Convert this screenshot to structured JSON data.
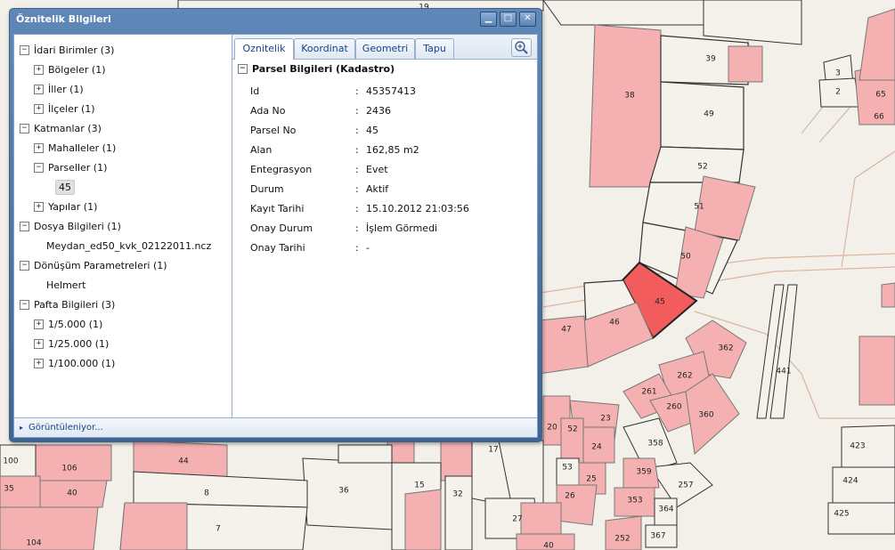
{
  "window": {
    "title": "Öznitelik Bilgileri",
    "buttons": {
      "minimize": "▁",
      "maximize": "□",
      "close": "✕"
    },
    "status_text": "Görüntüleniyor..."
  },
  "tree": [
    {
      "label": "İdari Birimler (3)",
      "expander": "−",
      "level": 0
    },
    {
      "label": "Bölgeler (1)",
      "expander": "+",
      "level": 1
    },
    {
      "label": "İller (1)",
      "expander": "+",
      "level": 1
    },
    {
      "label": "İlçeler (1)",
      "expander": "+",
      "level": 1
    },
    {
      "label": "Katmanlar (3)",
      "expander": "−",
      "level": 0
    },
    {
      "label": "Mahalleler (1)",
      "expander": "+",
      "level": 1
    },
    {
      "label": "Parseller (1)",
      "expander": "−",
      "level": 1
    },
    {
      "label": "45",
      "expander": "",
      "level": 2,
      "selected": true
    },
    {
      "label": "Yapılar (1)",
      "expander": "+",
      "level": 1
    },
    {
      "label": "Dosya Bilgileri (1)",
      "expander": "−",
      "level": 0
    },
    {
      "label": "Meydan_ed50_kvk_02122011.ncz",
      "expander": "",
      "level": 1
    },
    {
      "label": "Dönüşüm Parametreleri (1)",
      "expander": "−",
      "level": 0
    },
    {
      "label": "Helmert",
      "expander": "",
      "level": 1
    },
    {
      "label": "Pafta Bilgileri (3)",
      "expander": "−",
      "level": 0
    },
    {
      "label": "1/5.000 (1)",
      "expander": "+",
      "level": 1
    },
    {
      "label": "1/25.000 (1)",
      "expander": "+",
      "level": 1
    },
    {
      "label": "1/100.000 (1)",
      "expander": "+",
      "level": 1
    }
  ],
  "tabs": [
    {
      "label": "Oznitelik",
      "active": true
    },
    {
      "label": "Koordinat",
      "active": false
    },
    {
      "label": "Geometri",
      "active": false
    },
    {
      "label": "Tapu",
      "active": false
    }
  ],
  "section_title": "Parsel Bilgileri (Kadastro)",
  "section_expander": "−",
  "attributes": [
    {
      "key": "Id",
      "sep": ":",
      "value": "45357413"
    },
    {
      "key": "Ada No",
      "sep": ":",
      "value": "2436"
    },
    {
      "key": "Parsel No",
      "sep": ":",
      "value": "45"
    },
    {
      "key": "Alan",
      "sep": ":",
      "value": "162,85 m2"
    },
    {
      "key": "Entegrasyon",
      "sep": ":",
      "value": "Evet"
    },
    {
      "key": "Durum",
      "sep": ":",
      "value": "Aktif"
    },
    {
      "key": "Kayıt Tarihi",
      "sep": ":",
      "value": "15.10.2012 21:03:56"
    },
    {
      "key": "Onay Durum",
      "sep": ":",
      "value": "İşlem Görmedi"
    },
    {
      "key": "Onay Tarihi",
      "sep": ":",
      "value": "-"
    }
  ],
  "map": {
    "colors": {
      "background": "#f3f0ea",
      "building": "#f5b1b1",
      "selected": "#f25c5c",
      "outline": "#333333",
      "road_line": "#d7b7a0"
    },
    "parcel_numbers": [
      "19",
      "39",
      "38",
      "49",
      "52",
      "51",
      "50",
      "45",
      "46",
      "47",
      "3",
      "2",
      "65",
      "66",
      "362",
      "441",
      "262",
      "261",
      "260",
      "360",
      "23",
      "20",
      "52",
      "24",
      "53",
      "25",
      "26",
      "358",
      "359",
      "353",
      "257",
      "364",
      "367",
      "252",
      "44",
      "8",
      "7",
      "36",
      "15",
      "32",
      "27",
      "40",
      "17",
      "106",
      "40",
      "100",
      "35",
      "104",
      "423",
      "424",
      "425"
    ]
  }
}
